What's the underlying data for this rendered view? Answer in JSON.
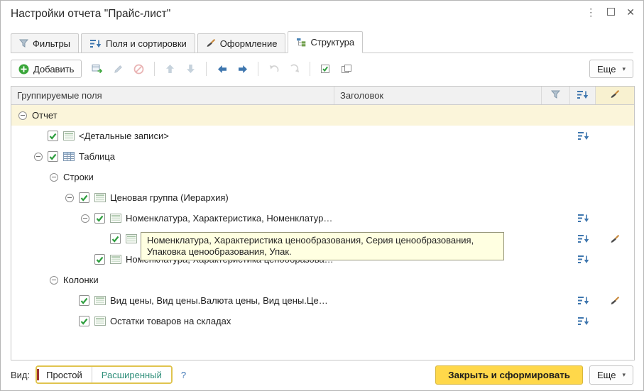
{
  "window": {
    "title": "Настройки отчета \"Прайс-лист\""
  },
  "window_controls": {
    "menu": "⋮",
    "close": "✕"
  },
  "icons": {
    "caret": "▾"
  },
  "tabs": [
    {
      "name": "tab-filters",
      "label": "Фильтры",
      "icon": "funnel-icon",
      "active": false
    },
    {
      "name": "tab-fields-sorting",
      "label": "Поля и сортировки",
      "icon": "fields-sort-icon",
      "active": false
    },
    {
      "name": "tab-appearance",
      "label": "Оформление",
      "icon": "appearance-brush-icon",
      "active": false
    },
    {
      "name": "tab-structure",
      "label": "Структура",
      "icon": "structure-icon",
      "active": true
    }
  ],
  "toolbar": {
    "more_label": "Еще",
    "buttons": [
      {
        "name": "add-button",
        "label": "Добавить",
        "icon": "plus-circle-icon",
        "enabled": true,
        "sep_after": false
      },
      {
        "name": "group-button",
        "icon": "group-icon",
        "enabled": true,
        "sep_after": false
      },
      {
        "name": "edit-button",
        "icon": "pencil-icon",
        "enabled": false,
        "sep_after": false
      },
      {
        "name": "delete-button",
        "icon": "delete-icon",
        "enabled": false,
        "sep_after": true
      },
      {
        "name": "move-up-button",
        "icon": "arrow-up-icon",
        "enabled": false,
        "sep_after": false
      },
      {
        "name": "move-down-button",
        "icon": "arrow-down-icon",
        "enabled": false,
        "sep_after": true
      },
      {
        "name": "move-left-button",
        "icon": "arrow-left-icon",
        "enabled": true,
        "sep_after": false
      },
      {
        "name": "move-right-button",
        "icon": "arrow-right-icon",
        "enabled": true,
        "sep_after": true
      },
      {
        "name": "move-level-up-button",
        "icon": "curved-arrow-up-icon",
        "enabled": false,
        "sep_after": false
      },
      {
        "name": "move-level-down-button",
        "icon": "curved-arrow-down-icon",
        "enabled": false,
        "sep_after": true
      },
      {
        "name": "check-all-button",
        "icon": "check-all-icon",
        "enabled": true,
        "sep_after": false
      },
      {
        "name": "uncheck-all-button",
        "icon": "uncheck-all-icon",
        "enabled": true,
        "sep_after": false
      }
    ]
  },
  "grid": {
    "headers": {
      "fields": "Группируемые поля",
      "title": "Заголовок"
    }
  },
  "tree": {
    "rows": [
      {
        "label": "Отчет",
        "indent": 0,
        "expander": true,
        "checkbox": false,
        "icon": null,
        "sort": false,
        "brush": false,
        "highlighted": true
      },
      {
        "label": "<Детальные записи>",
        "indent": 1,
        "expander": false,
        "checkbox": true,
        "icon": "field",
        "sort": true,
        "brush": false,
        "highlighted": false
      },
      {
        "label": "Таблица",
        "indent": 1,
        "expander": true,
        "checkbox": true,
        "icon": "table",
        "sort": false,
        "brush": false,
        "highlighted": false
      },
      {
        "label": "Строки",
        "indent": 2,
        "expander": true,
        "checkbox": false,
        "icon": null,
        "sort": false,
        "brush": false,
        "highlighted": false
      },
      {
        "label": "Ценовая группа (Иерархия)",
        "indent": 3,
        "expander": true,
        "checkbox": true,
        "icon": "field",
        "sort": false,
        "brush": false,
        "highlighted": false
      },
      {
        "label": "Номенклатура, Характеристика, Номенклатур…",
        "indent": 4,
        "expander": true,
        "checkbox": true,
        "icon": "field",
        "sort": true,
        "brush": false,
        "highlighted": false
      },
      {
        "label": "",
        "indent": 5,
        "expander": false,
        "checkbox": true,
        "icon": "field",
        "sort": true,
        "brush": true,
        "highlighted": false
      },
      {
        "label": "Номенклатура, Характеристика ценообразова…",
        "indent": 4,
        "expander": false,
        "checkbox": true,
        "icon": "field",
        "sort": true,
        "brush": false,
        "highlighted": false
      },
      {
        "label": "Колонки",
        "indent": 2,
        "expander": true,
        "checkbox": false,
        "icon": null,
        "sort": false,
        "brush": false,
        "highlighted": false
      },
      {
        "label": "Вид цены, Вид цены.Валюта цены, Вид цены.Це…",
        "indent": 3,
        "expander": false,
        "checkbox": true,
        "icon": "field",
        "sort": true,
        "brush": true,
        "highlighted": false
      },
      {
        "label": "Остатки товаров на складах",
        "indent": 3,
        "expander": false,
        "checkbox": true,
        "icon": "field",
        "sort": true,
        "brush": false,
        "highlighted": false
      }
    ]
  },
  "tooltip": {
    "text": "Номенклатура, Характеристика ценообразования, Серия ценообразования, Упаковка ценообразования, Упак."
  },
  "footer": {
    "view_label": "Вид:",
    "mode_simple": "Простой",
    "mode_extended": "Расширенный",
    "help": "?",
    "close_button": "Закрыть и сформировать",
    "more_button": "Еще"
  },
  "colors": {
    "accent_yellow": "#ffd84a",
    "row_highlight": "#fbf5da",
    "tooltip_bg": "#ffffe1",
    "check_green": "#2f9e3f",
    "icon_blue": "#3e76ae",
    "header_brush_cell": "#f8f1d0"
  }
}
